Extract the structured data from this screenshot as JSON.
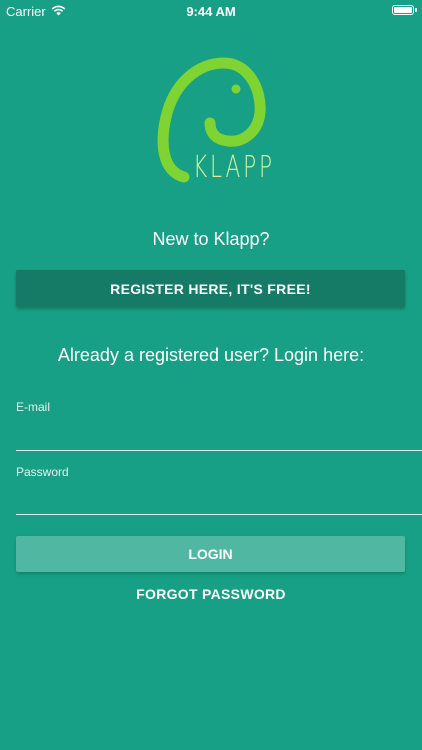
{
  "status_bar": {
    "carrier": "Carrier",
    "time": "9:44 AM",
    "battery_level": 1.0
  },
  "logo": {
    "text": "KLAPP",
    "colors": {
      "outline": "#7fd332",
      "text": "#d9f0a0"
    }
  },
  "register": {
    "prompt": "New to Klapp?",
    "button_label": "REGISTER HERE, IT'S FREE!"
  },
  "login": {
    "prompt": "Already a registered user? Login here:",
    "email_label": "E-mail",
    "email_value": "",
    "password_label": "Password",
    "password_value": "",
    "button_label": "LOGIN",
    "forgot_label": "FORGOT PASSWORD"
  },
  "colors": {
    "background": "#17a085",
    "register_button": "#157a66",
    "login_button": "#50b8a2"
  },
  "icons": {
    "wifi": "wifi-icon",
    "battery": "battery-icon",
    "logo": "elephant-logo-icon"
  }
}
